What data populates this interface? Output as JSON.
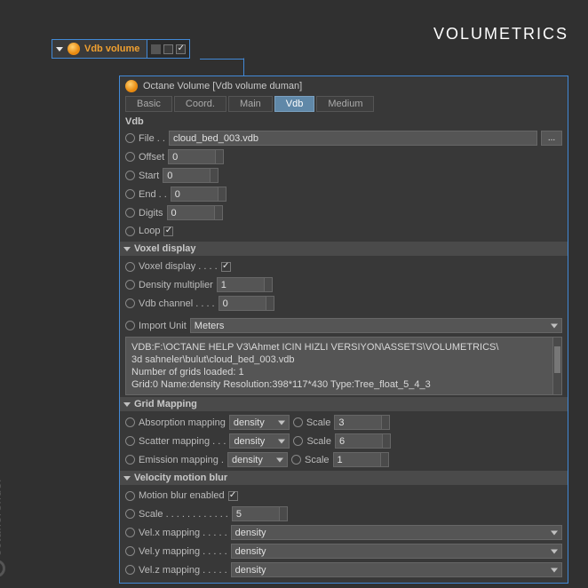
{
  "header": {
    "title": "VOLUMETRICS"
  },
  "node": {
    "label": "Vdb volume"
  },
  "panel": {
    "title": "Octane Volume [Vdb volume duman]",
    "tabs": [
      "Basic",
      "Coord.",
      "Main",
      "Vdb",
      "Medium"
    ],
    "active_tab": "Vdb"
  },
  "vdb": {
    "section": "Vdb",
    "file_label": "File . .",
    "file_value": "cloud_bed_003.vdb",
    "offset_label": "Offset",
    "offset_value": "0",
    "start_label": "Start",
    "start_value": "0",
    "end_label": "End . .",
    "end_value": "0",
    "digits_label": "Digits",
    "digits_value": "0",
    "loop_label": "Loop"
  },
  "voxel": {
    "section": "Voxel display",
    "display_label": "Voxel display . . . .",
    "density_label": "Density multiplier",
    "density_value": "1",
    "channel_label": "Vdb channel . . . .",
    "channel_value": "0"
  },
  "import": {
    "label": "Import Unit",
    "unit": "Meters",
    "info_line1": "VDB:F:\\OCTANE HELP V3\\Ahmet ICIN HIZLI VERSIYON\\ASSETS\\VOLUMETRICS\\",
    "info_line2": "3d sahneler\\bulut\\cloud_bed_003.vdb",
    "info_line3": "Number of grids loaded: 1",
    "info_line4": "Grid:0  Name:density  Resolution:398*117*430  Type:Tree_float_5_4_3"
  },
  "grid": {
    "section": "Grid Mapping",
    "absorption_label": "Absorption mapping",
    "scatter_label": "Scatter mapping . . .",
    "emission_label": "Emission mapping .",
    "mapping_value": "density",
    "scale_label": "Scale",
    "absorption_scale": "3",
    "scatter_scale": "6",
    "emission_scale": "1"
  },
  "velocity": {
    "section": "Velocity motion blur",
    "enabled_label": "Motion blur enabled",
    "scale_label": "Scale . . . . . . . . . . . .",
    "scale_value": "5",
    "velx_label": "Vel.x mapping . . . . .",
    "vely_label": "Vel.y mapping . . . . .",
    "velz_label": "Vel.z mapping . . . . .",
    "vel_value": "density"
  },
  "brand": "octanerender"
}
